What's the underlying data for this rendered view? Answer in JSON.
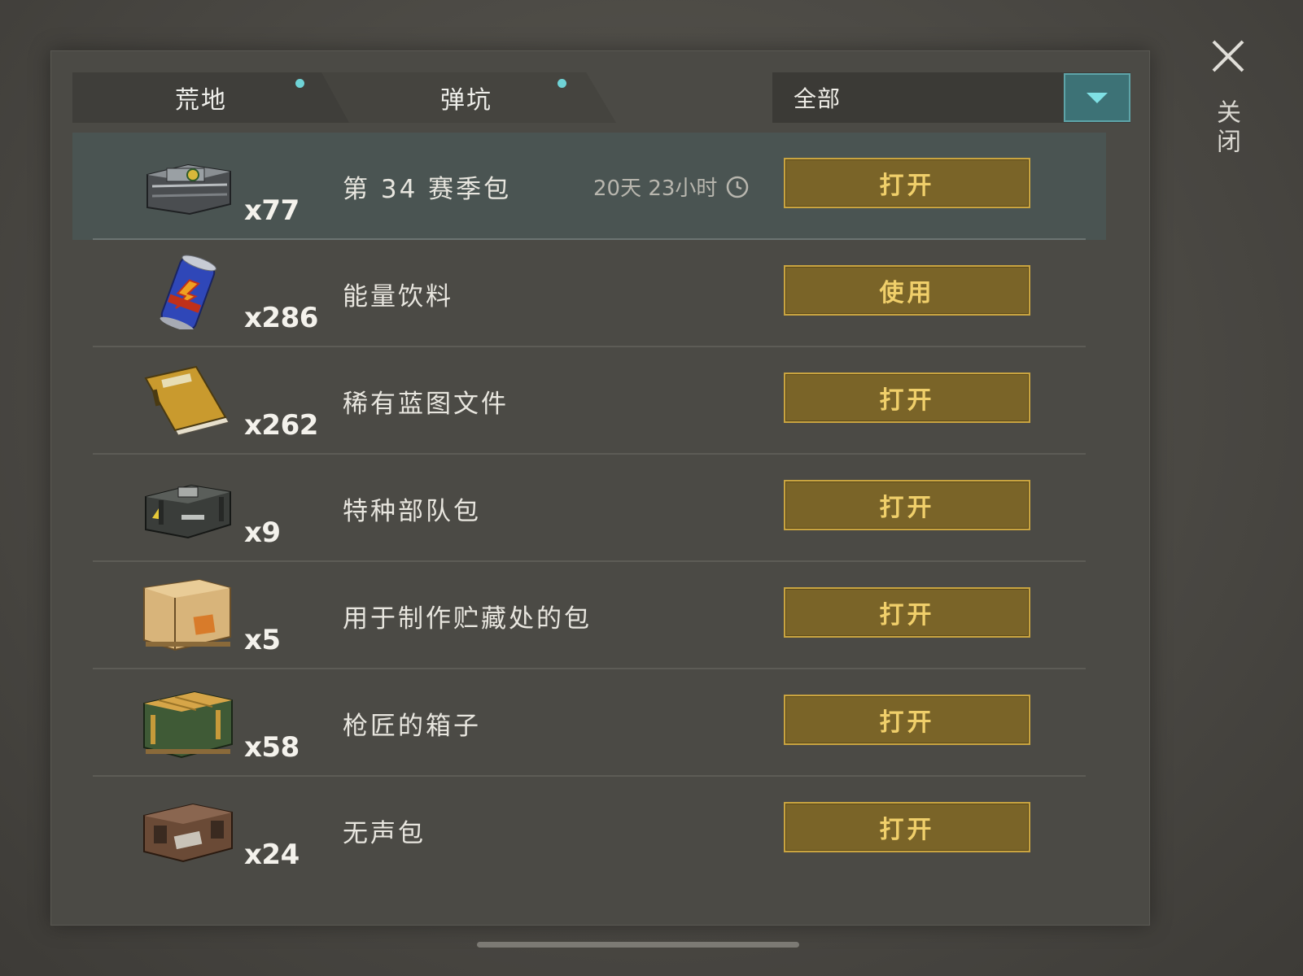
{
  "tabs": [
    {
      "label": "荒地",
      "active": true
    },
    {
      "label": "弹坑",
      "active": false
    }
  ],
  "filter": {
    "value": "全部"
  },
  "close_label": "关闭",
  "items": [
    {
      "qty": "x77",
      "name": "第 34 赛季包",
      "timer": "20天 23小时",
      "action": "打开",
      "icon": "season-crate-icon"
    },
    {
      "qty": "x286",
      "name": "能量饮料",
      "action": "使用",
      "icon": "energy-drink-icon"
    },
    {
      "qty": "x262",
      "name": "稀有蓝图文件",
      "action": "打开",
      "icon": "blueprint-folder-icon"
    },
    {
      "qty": "x9",
      "name": "特种部队包",
      "action": "打开",
      "icon": "military-case-icon"
    },
    {
      "qty": "x5",
      "name": "用于制作贮藏处的包",
      "action": "打开",
      "icon": "furniture-box-icon"
    },
    {
      "qty": "x58",
      "name": "枪匠的箱子",
      "action": "打开",
      "icon": "gunsmith-crate-icon"
    },
    {
      "qty": "x24",
      "name": "无声包",
      "action": "打开",
      "icon": "silent-case-icon"
    }
  ],
  "colors": {
    "accent_teal": "#6fd3d6",
    "button_gold": "#c9a440",
    "button_fill": "#7a6428"
  }
}
